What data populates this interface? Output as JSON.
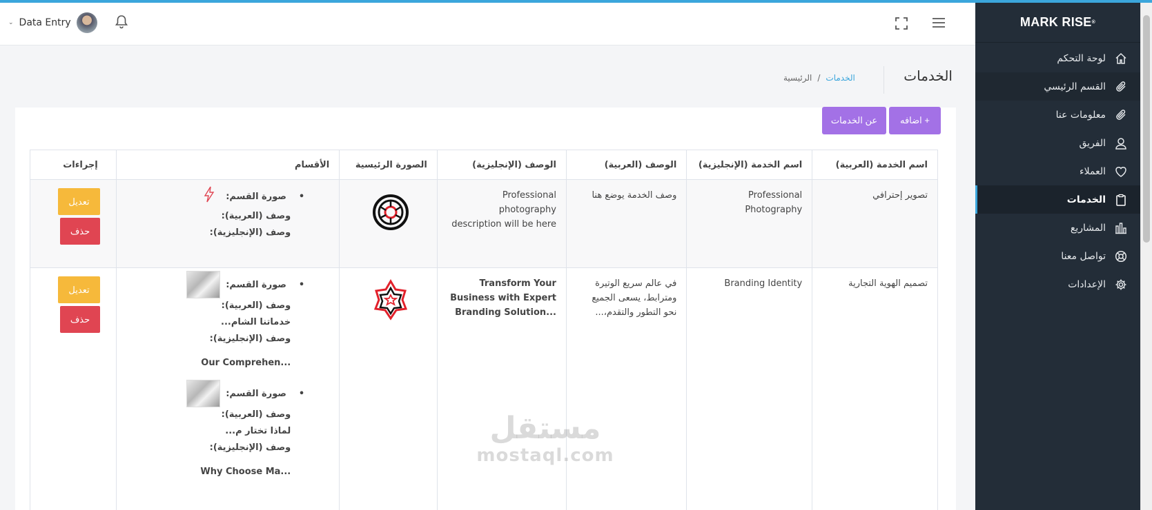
{
  "brand": {
    "name": "MARK RISE",
    "mark": "®"
  },
  "header": {
    "user_name": "Data Entry"
  },
  "sidebar": {
    "items": [
      {
        "label": "لوحة التحكم",
        "icon": "home-icon"
      },
      {
        "label": "القسم الرئيسي",
        "icon": "paperclip-icon"
      },
      {
        "label": "معلومات عنا",
        "icon": "paperclip-icon"
      },
      {
        "label": "الفريق",
        "icon": "user-icon"
      },
      {
        "label": "العملاء",
        "icon": "heart-icon"
      },
      {
        "label": "الخدمات",
        "icon": "clipboard-icon"
      },
      {
        "label": "المشاريع",
        "icon": "bar-chart-icon"
      },
      {
        "label": "تواصل معنا",
        "icon": "support-icon"
      },
      {
        "label": "الإعدادات",
        "icon": "gear-icon"
      }
    ],
    "active_index": 5
  },
  "page": {
    "title": "الخدمات",
    "breadcrumb": {
      "link": "الخدمات",
      "separator": "/",
      "current": "الرئيسية"
    }
  },
  "actions": {
    "add_label": "اضافه +",
    "about_label": "عن الخدمات"
  },
  "table": {
    "headers": [
      "اسم الخدمة (العربية)",
      "اسم الخدمة (الإنجليزية)",
      "الوصف (العربية)",
      "الوصف (الإنجليزية)",
      "الصورة الرئيسية",
      "الأقسام",
      "إجراءات"
    ],
    "rows": [
      {
        "name_ar": "تصوير إحترافي",
        "name_en": "Professional Photography",
        "desc_ar": "وصف الخدمة يوضع هنا",
        "desc_en": "Professional photography description will be here",
        "categories": [
          {
            "image_label": "صورة القسم:",
            "desc_ar_label": "وصف (العربية):",
            "desc_ar": "",
            "desc_en_label": "وصف (الإنجليزية):",
            "desc_en": ""
          }
        ]
      },
      {
        "name_ar": "تصميم الهوية التجارية",
        "name_en": "Branding Identity",
        "desc_ar": "في عالم سريع الوتيرة ومترابط، يسعى الجميع نحو التطور والتقدم،...",
        "desc_en": "Transform Your Business with Expert Branding Solution...",
        "categories": [
          {
            "image_label": "صورة القسم:",
            "desc_ar_label": "وصف (العربية):",
            "desc_ar": "خدماتنا الشام...",
            "desc_en_label": "وصف (الإنجليزية):",
            "desc_en": "Our Comprehen..."
          },
          {
            "image_label": "صورة القسم:",
            "desc_ar_label": "وصف (العربية):",
            "desc_ar": "لماذا تختار م...",
            "desc_en_label": "وصف (الإنجليزية):",
            "desc_en": "Why Choose Ma..."
          }
        ]
      }
    ],
    "edit_label": "تعديل",
    "delete_label": "حذف"
  },
  "watermark": {
    "arabic": "مستقل",
    "latin": "mostaql.com"
  },
  "colors": {
    "accent": "#3ba6dc",
    "sidebar": "#232d38",
    "purple": "#a371e6",
    "edit": "#f6b93b",
    "delete": "#e04552"
  }
}
